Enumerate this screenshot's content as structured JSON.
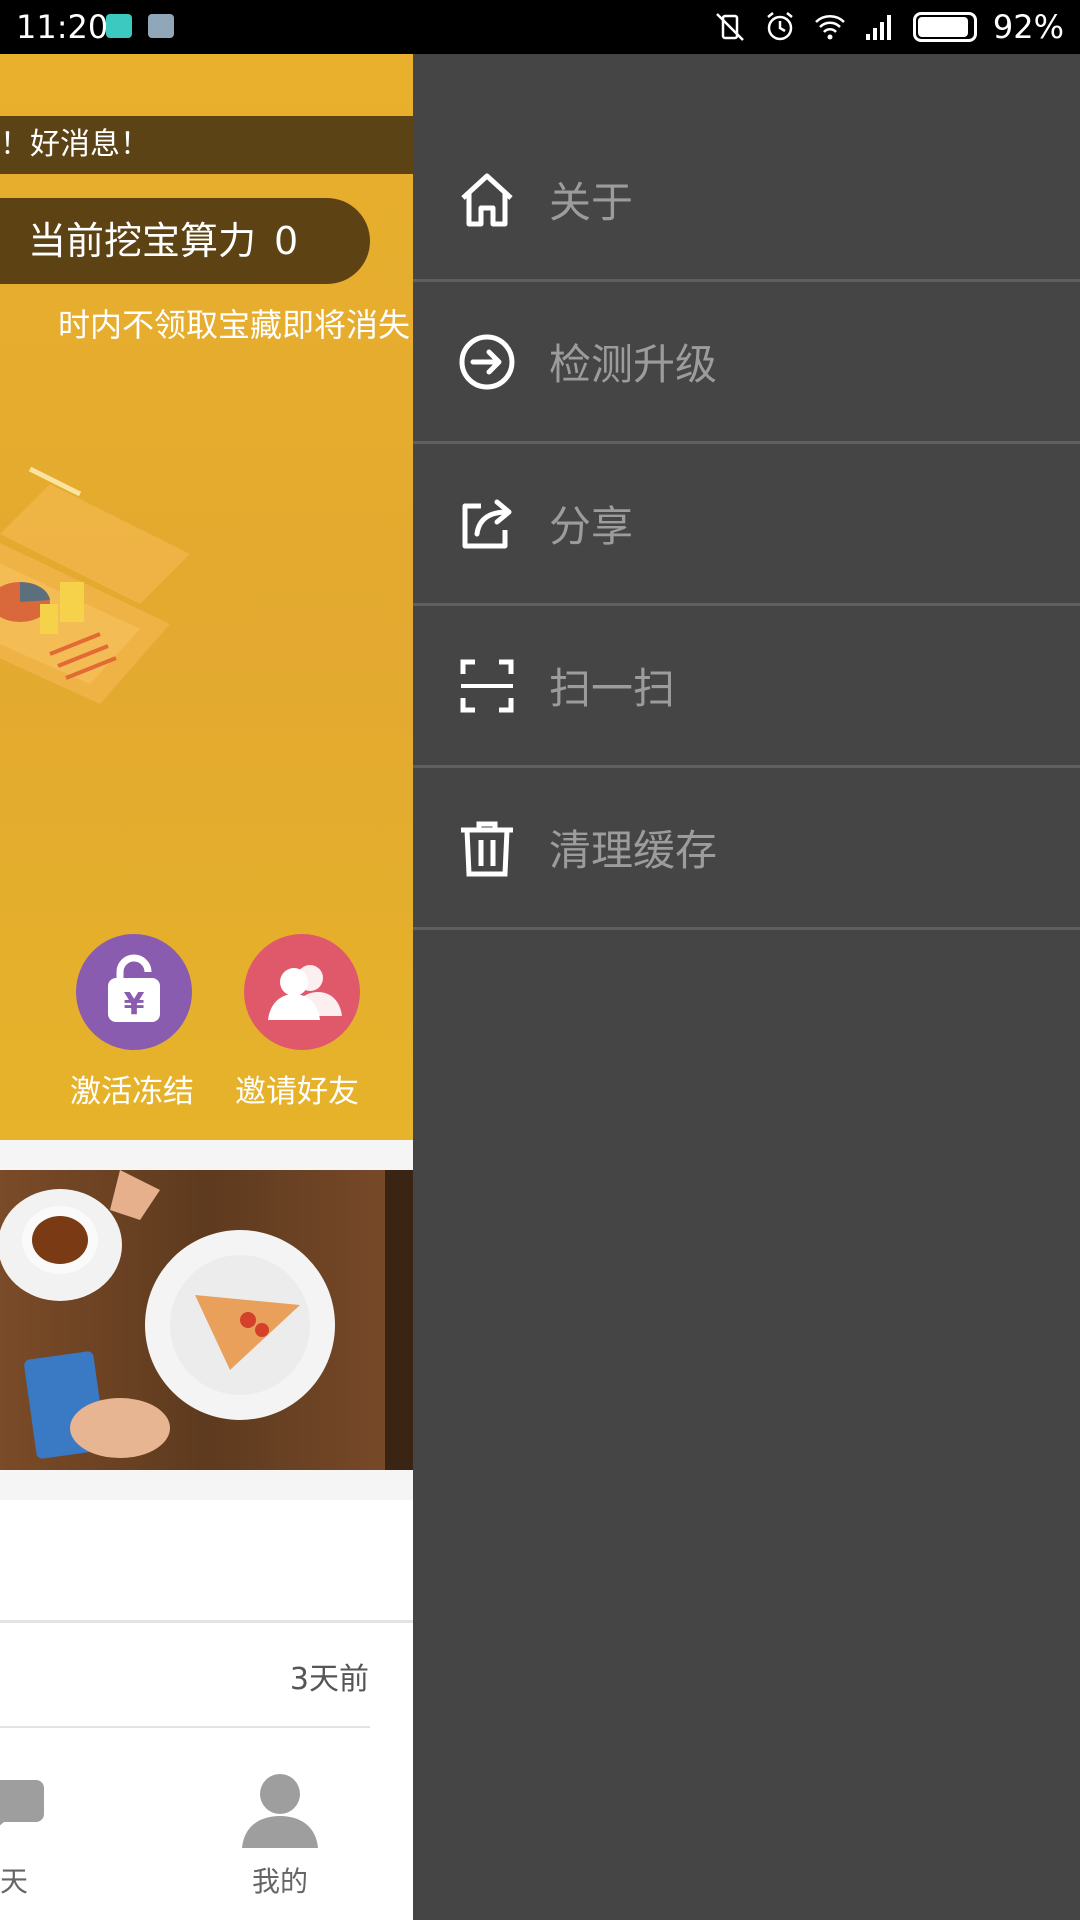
{
  "status_bar": {
    "time": "11:20",
    "battery": "92%",
    "battery_level": 0.92,
    "icons": [
      "boss-app-icon",
      "notes-app-icon",
      "vibrate-off-icon",
      "alarm-icon",
      "wifi-icon",
      "signal-icon",
      "battery-icon"
    ]
  },
  "home": {
    "ticker": "！好消息！",
    "power_label": "当前挖宝算力",
    "power_value": "0",
    "notice": "时内不领取宝藏即将消失",
    "actions": [
      {
        "label": "激活冻结",
        "icon": "unlock-yuan-icon",
        "color": "#8a5cb0"
      },
      {
        "label": "邀请好友",
        "icon": "friends-icon",
        "color": "#e0596a"
      }
    ],
    "time_ago": "3天前",
    "tabs": [
      {
        "label": "聊天",
        "icon": "chat-icon"
      },
      {
        "label": "我的",
        "icon": "profile-icon"
      }
    ],
    "accent_color": "#e4ab2e"
  },
  "drawer": {
    "items": [
      {
        "label": "关于",
        "icon": "home-icon"
      },
      {
        "label": "检测升级",
        "icon": "arrow-circle-icon"
      },
      {
        "label": "分享",
        "icon": "share-icon"
      },
      {
        "label": "扫一扫",
        "icon": "scan-icon"
      },
      {
        "label": "清理缓存",
        "icon": "trash-icon"
      }
    ],
    "background": "#454545"
  }
}
